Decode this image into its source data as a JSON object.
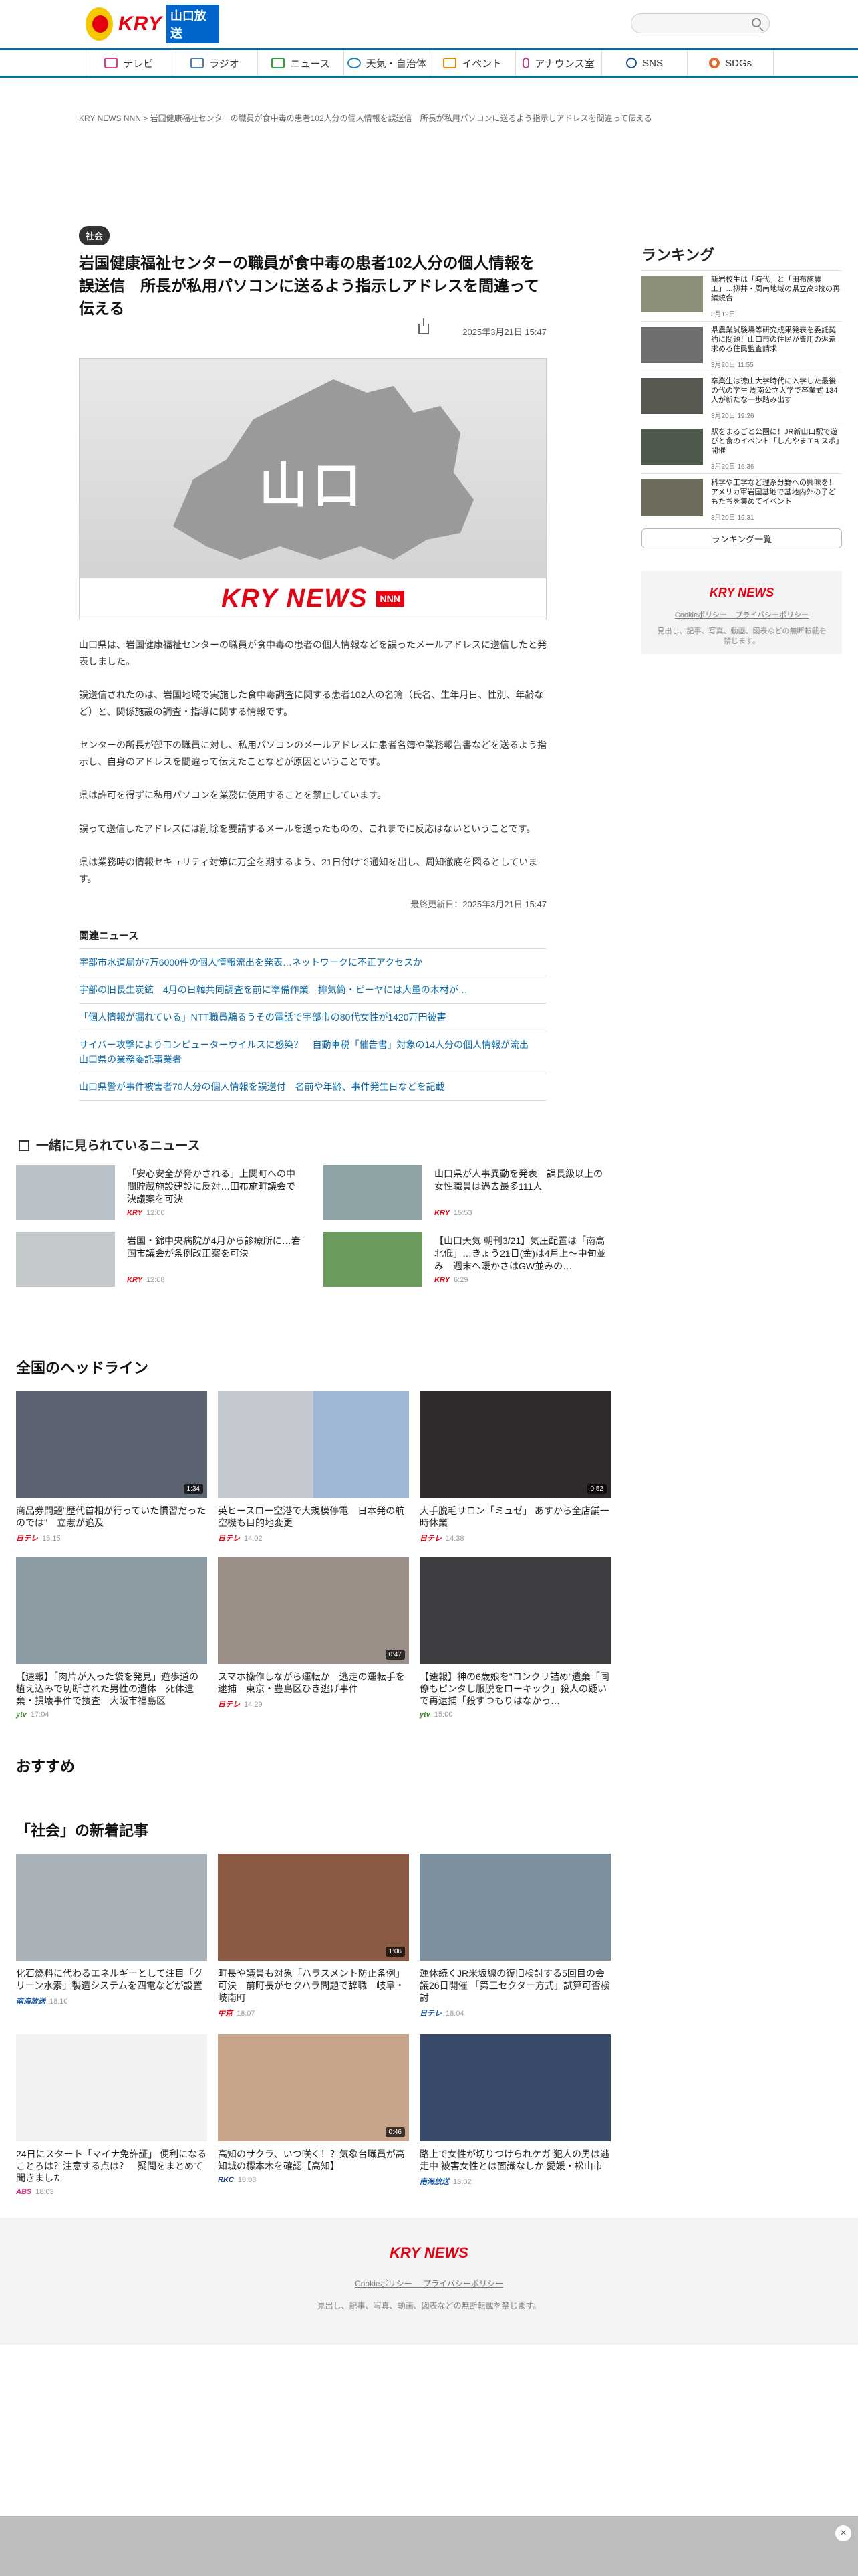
{
  "header": {
    "logo_text": "KRY",
    "logo_sub": "山口放送"
  },
  "nav": {
    "items": [
      {
        "label": "テレビ",
        "icon": "tv-icon",
        "color": "#d63d8a"
      },
      {
        "label": "ラジオ",
        "icon": "radio-icon",
        "color": "#4d7fb0"
      },
      {
        "label": "ニュース",
        "icon": "news-icon",
        "color": "#2aa23a"
      },
      {
        "label": "天気・自治体",
        "icon": "weather-icon",
        "color": "#1d80c8"
      },
      {
        "label": "イベント",
        "icon": "event-icon",
        "color": "#e88a00"
      },
      {
        "label": "アナウンス室",
        "icon": "mic-icon",
        "color": "#c0408c"
      },
      {
        "label": "SNS",
        "icon": "sns-icon",
        "color": "#1d4f9e"
      },
      {
        "label": "SDGs",
        "icon": "sdgs-icon",
        "color": "#e0682b"
      }
    ]
  },
  "breadcrumb": {
    "home": "KRY NEWS NNN",
    "separator": ">",
    "current": "岩国健康福祉センターの職員が食中毒の患者102人分の個人情報を誤送信　所長が私用パソコンに送るよう指示しアドレスを間違って伝える"
  },
  "article": {
    "category": "社会",
    "title": "岩国健康福祉センターの職員が食中毒の患者102人分の個人情報を誤送信　所長が私用パソコンに送るよう指示しアドレスを間違って伝える",
    "published": "2025年3月21日 15:47",
    "image_text": "山口",
    "image_logo": "KRY NEWS",
    "image_badge": "NNN",
    "paragraphs": [
      "山口県は、岩国健康福祉センターの職員が食中毒の患者の個人情報などを誤ったメールアドレスに送信したと発表しました。",
      "誤送信されたのは、岩国地域で実施した食中毒調査に関する患者102人の名簿（氏名、生年月日、性別、年齢など）と、関係施設の調査・指導に関する情報です。",
      "センターの所長が部下の職員に対し、私用パソコンのメールアドレスに患者名簿や業務報告書などを送るよう指示し、自身のアドレスを間違って伝えたことなどが原因ということです。",
      "県は許可を得ずに私用パソコンを業務に使用することを禁止しています。",
      "誤って送信したアドレスには削除を要請するメールを送ったものの、これまでに反応はないということです。",
      "県は業務時の情報セキュリティ対策に万全を期するよう、21日付けで通知を出し、周知徹底を図るとしています。"
    ],
    "updated": "最終更新日：2025年3月21日 15:47"
  },
  "related": {
    "title": "関連ニュース",
    "items": [
      "宇部市水道局が7万6000件の個人情報流出を発表…ネットワークに不正アクセスか",
      "宇部の旧長生炭鉱　4月の日韓共同調査を前に準備作業　排気筒・ピーヤには大量の木材が…",
      "「個人情報が漏れている」NTT職員騙るうその電話で宇部市の80代女性が1420万円被害",
      "サイバー攻撃によりコンピューターウイルスに感染？　自動車税「催告書」対象の14人分の個人情報が流出　山口県の業務委託事業者",
      "山口県警が事件被害者70人分の個人情報を誤送付　名前や年齢、事件発生日などを記載"
    ]
  },
  "ranking": {
    "title": "ランキング",
    "items": [
      {
        "title": "新岩校生は「時代」と「田布施農工」…柳井・周南地域の県立高3校の再編統合",
        "date": "3月19日"
      },
      {
        "title": "県農業試験場等研究成果発表を委託契約に問題！山口市の住民が費用の返還求める住民監査請求",
        "date": "3月20日 11:55"
      },
      {
        "title": "卒業生は徳山大学時代に入学した最後の代の学生 周南公立大学で卒業式 134人が新たな一歩踏み出す",
        "date": "3月20日 19:26"
      },
      {
        "title": "駅をまるごと公園に！JR新山口駅で遊びと食のイベント「しんやまエキスポ」開催",
        "date": "3月20日 16:36"
      },
      {
        "title": "科学や工学など理系分野への興味を！アメリカ軍岩国基地で基地内外の子どもたちを集めてイベント",
        "date": "3月20日 19:31"
      }
    ],
    "more_label": "ランキング一覧"
  },
  "side_box": {
    "logo": "KRY NEWS",
    "cookie_policy": "Cookieポリシー",
    "privacy_policy": "プライバシーポリシー",
    "note": "見出し、記事、写真、動画、図表などの無断転載を禁じます。"
  },
  "together": {
    "title": "一緒に見られているニュース",
    "items": [
      {
        "title": "「安心安全が脅かされる」上関町への中間貯蔵施設建設に反対…田布施町議会で決議案を可決",
        "source": "KRY",
        "time": "12:00"
      },
      {
        "title": "山口県が人事異動を発表　課長級以上の女性職員は過去最多111人",
        "source": "KRY",
        "time": "15:53"
      },
      {
        "title": "岩国・錦中央病院が4月から診療所に…岩国市議会が条例改正案を可決",
        "source": "KRY",
        "time": "12:08"
      },
      {
        "title": "【山口天気 朝刊3/21】気圧配置は「南高北低」…きょう21日(金)は4月上～中旬並み　週末へ暖かさはGW並みの…",
        "source": "KRY",
        "time": "6:29"
      }
    ]
  },
  "headlines": {
    "title": "全国のヘッドライン",
    "items": [
      {
        "title": "商品券問題\"歴代首相が行っていた慣習だったのでは\"　立憲が追及",
        "source": "日テレ",
        "time": "15:15",
        "duration": "1:34"
      },
      {
        "title": "英ヒースロー空港で大規模停電　日本発の航空機も目的地変更",
        "source": "日テレ",
        "time": "14:02",
        "duration": ""
      },
      {
        "title": "大手脱毛サロン「ミュゼ」 あすから全店舗一時休業",
        "source": "日テレ",
        "time": "14:38",
        "duration": "0:52"
      },
      {
        "title": "【速報】「肉片が入った袋を発見」遊歩道の植え込みで切断された男性の遺体　死体遺棄・損壊事件で捜査　大阪市福島区",
        "source": "ytv",
        "time": "17:04",
        "duration": ""
      },
      {
        "title": "スマホ操作しながら運転か　逃走の運転手を逮捕　東京・豊島区ひき逃げ事件",
        "source": "日テレ",
        "time": "14:29",
        "duration": "0:47"
      },
      {
        "title": "【速報】神の6歳娘を\"コンクリ詰め\"遺棄「同僚もピンタし服脱をローキック」殺人の疑いで再逮捕「殺すつもりはなかっ…",
        "source": "ytv",
        "time": "15:00",
        "duration": ""
      }
    ]
  },
  "recommend": {
    "title": "おすすめ"
  },
  "social": {
    "title": "「社会」の新着記事",
    "items": [
      {
        "title": "化石燃料に代わるエネルギーとして注目「グリーン水素」製造システムを四電などが設置",
        "source": "南海放送",
        "time": "18:10",
        "duration": ""
      },
      {
        "title": "町長や議員も対象「ハラスメント防止条例」可決　前町長がセクハラ問題で辞職　岐阜・岐南町",
        "source": "中京",
        "time": "18:07",
        "duration": "1:06"
      },
      {
        "title": "運休続くJR米坂線の復旧検討する5回目の会議26日開催 「第三セクター方式」試算可否検討",
        "source": "日テレ",
        "time": "18:04",
        "duration": ""
      },
      {
        "title": "24日にスタート「マイナ免許証」 便利になることろは？注意する点は？　疑問をまとめて聞きました",
        "source": "ABS",
        "time": "18:03",
        "duration": ""
      },
      {
        "title": "高知のサクラ、いつ咲く！？気象台職員が高知城の標本木を確認【高知】",
        "source": "RKC",
        "time": "18:03",
        "duration": "0:46"
      },
      {
        "title": "路上で女性が切りつけられケガ 犯人の男は逃走中 被害女性とは面識なしか 愛媛・松山市",
        "source": "南海放送",
        "time": "18:02",
        "duration": ""
      }
    ]
  },
  "footer": {
    "logo": "KRY NEWS",
    "cookie_policy": "Cookieポリシー",
    "privacy_policy": "プライバシーポリシー",
    "note": "見出し、記事、写真、動画、図表などの無断転載を禁じます。"
  },
  "colors": {
    "accent": "#e60012",
    "nav_border": "#0b6aa8",
    "link": "#0b6aa8"
  }
}
